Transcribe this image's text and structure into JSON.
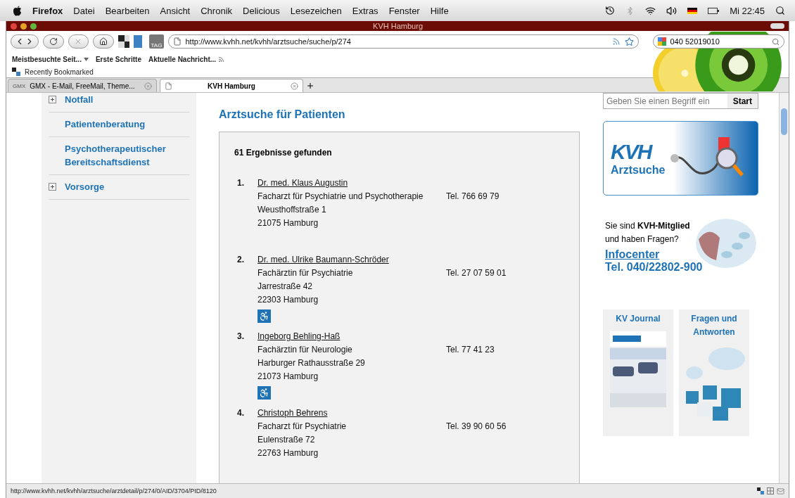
{
  "menubar": {
    "app": "Firefox",
    "menus": [
      "Datei",
      "Bearbeiten",
      "Ansicht",
      "Chronik",
      "Delicious",
      "Lesezeichen",
      "Extras",
      "Fenster",
      "Hilfe"
    ],
    "clock": "Mi 22:45"
  },
  "window": {
    "title": "KVH Hamburg"
  },
  "toolbar": {
    "url": "http://www.kvhh.net/kvhh/arztsuche/suche/p/274",
    "search_value": "040 52019010",
    "tag_label": "TAG"
  },
  "bookmarks": [
    {
      "label": "Meistbesuchte Seit...",
      "kind": "folder"
    },
    {
      "label": "Erste Schritte",
      "kind": "link"
    },
    {
      "label": "Aktuelle Nachricht...",
      "kind": "feed"
    }
  ],
  "bookmarks_bar_2": {
    "label": "Recently Bookmarked"
  },
  "tabs": [
    {
      "label": "GMX - E-Mail, FreeMail, Theme...",
      "favicon": "GMX",
      "selected": false
    },
    {
      "label": "KVH Hamburg",
      "selected": true
    }
  ],
  "sidebar": {
    "items": [
      {
        "label": "Notfall",
        "expandable": true
      },
      {
        "label": "Patientenberatung",
        "expandable": false
      },
      {
        "label": "Psychotherapeutischer Bereitschaftsdienst",
        "expandable": false
      },
      {
        "label": "Vorsorge",
        "expandable": true
      }
    ]
  },
  "main": {
    "heading": "Arztsuche für Patienten",
    "result_count": "61 Ergebnisse gefunden",
    "results": [
      {
        "number": "1.",
        "name": "Dr. med. Klaus Augustin",
        "specialty": "Facharzt für Psychiatrie und Psychotherapie",
        "phone": "Tel. 766 69 79",
        "street": "Weusthoffstraße 1",
        "city": "21075 Hamburg",
        "wheelchair_accessible": false
      },
      {
        "number": "2.",
        "name": "Dr. med. Ulrike Baumann-Schröder",
        "specialty": "Fachärztin für Psychiatrie",
        "phone": "Tel. 27 07 59 01",
        "street": "Jarrestraße 42",
        "city": "22303 Hamburg",
        "wheelchair_accessible": true
      },
      {
        "number": "3.",
        "name": "Ingeborg Behling-Haß",
        "specialty": "Fachärztin für Neurologie",
        "phone": "Tel. 77 41 23",
        "street": "Harburger Rathausstraße 29",
        "city": "21073 Hamburg",
        "wheelchair_accessible": true
      },
      {
        "number": "4.",
        "name": "Christoph Behrens",
        "specialty": "Facharzt für Psychiatrie",
        "phone": "Tel. 39 90 60 56",
        "street": "Eulenstraße 72",
        "city": "22763 Hamburg",
        "wheelchair_accessible": false
      }
    ]
  },
  "right": {
    "search_placeholder": "Geben Sie einen Begriff ein",
    "search_button": "Start",
    "banner": {
      "logo": "KVH",
      "title": "Arztsuche"
    },
    "info": {
      "text_1": "Sie sind **KVH-Mitglied**",
      "text_2": "und haben Fragen?",
      "link": "Infocenter",
      "phone": "Tel. 040/22802-900"
    },
    "cards": [
      {
        "title": "KV Journal",
        "kind": "journal"
      },
      {
        "title": "Fragen und Antworten",
        "kind": "questions"
      }
    ]
  },
  "status_bar": {
    "url": "http://www.kvhh.net/kvhh/arztsuche/arztdetail/p/274/0/AID/3704/PID/8120"
  }
}
